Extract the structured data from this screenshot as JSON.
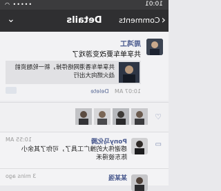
{
  "status_bar": {
    "time": "10:01",
    "signal": "••••• ◠"
  },
  "nav": {
    "back_label": "Comments",
    "title": "Details",
    "more": "⌄"
  },
  "post": {
    "author": "周鸿工",
    "text": "共享单车要改变游戏了",
    "link_title_line1": "共享单车香港网络停掉，新一轮融资前",
    "link_title_line2": "战火燃向大出行",
    "time": "10:07 AM",
    "delete_label": "Delete"
  },
  "likes": {
    "icon": "heart-icon"
  },
  "comments": [
    {
      "name": "Pony马化腾",
      "time": "10:55 AM",
      "line1": "感谢伟大的推广工具了，可你了其余小",
      "line2": "陈东彼得禾"
    },
    {
      "name": "某某强",
      "time": "3 mins ago",
      "line1": "",
      "line2": ""
    }
  ]
}
